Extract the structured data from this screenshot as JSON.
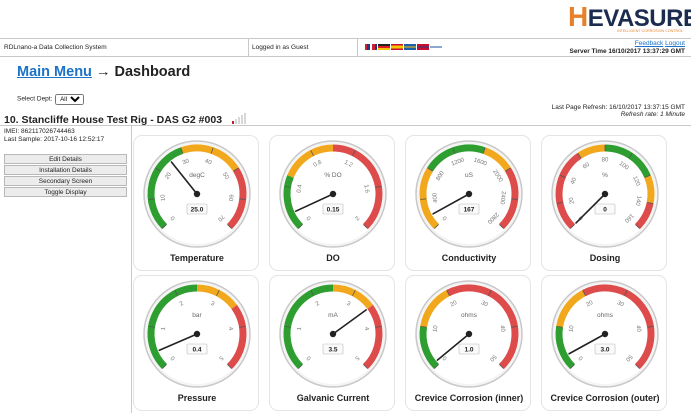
{
  "brand": {
    "name_h": "H",
    "name_rest": "EVASURE",
    "tagline": "INTELLIGENT CORROSION CONTROL"
  },
  "infobar": {
    "system": "RDLnano-a Data Collection System",
    "logged": "Logged in as Guest",
    "feedback": "Feedback",
    "logout": "Logout",
    "server_time": "Server Time 16/10/2017 13:37:29 GMT"
  },
  "breadcrumb": {
    "main": "Main Menu",
    "arrow": "→",
    "current": "Dashboard"
  },
  "dept": {
    "label": "Select Dept:",
    "value": "All"
  },
  "refresh": {
    "last": "Last Page Refresh: 16/10/2017 13:37:15 GMT",
    "rate": "Refresh rate: 1 Minute"
  },
  "rig": {
    "title": "10. Stancliffe House Test Rig - DAS G2 #003",
    "signal_bars": 1
  },
  "device": {
    "imei": "IMEI: 862117026744463",
    "last_sample": "Last Sample: 2017-10-16 12:52:17"
  },
  "menu": [
    "Edit Details",
    "Installation Details",
    "Secondary Screen",
    "Toggle Display"
  ],
  "colors": {
    "green": "#2e9e31",
    "amber": "#f2a81d",
    "red": "#dd4b4b",
    "link": "#1a73c8"
  },
  "gauges": [
    {
      "label": "Temperature",
      "unit": "degC",
      "value": 25.0,
      "display": "25.0",
      "min": 0,
      "max": 70,
      "ticks": [
        "0",
        "10",
        "20",
        "30",
        "40",
        "50",
        "60",
        "70"
      ],
      "zones": [
        [
          "green",
          0,
          30
        ],
        [
          "amber",
          30,
          50
        ],
        [
          "red",
          50,
          70
        ]
      ]
    },
    {
      "label": "DO",
      "unit": "% DO",
      "value": 0.15,
      "display": "0.15",
      "min": 0,
      "max": 2,
      "ticks": [
        "0",
        "0.4",
        "0.8",
        "1.2",
        "1.6",
        "2"
      ],
      "zones": [
        [
          "green",
          0,
          0.5
        ],
        [
          "amber",
          0.5,
          1.0
        ],
        [
          "red",
          1.0,
          2.0
        ]
      ]
    },
    {
      "label": "Conductivity",
      "unit": "uS",
      "value": 167,
      "display": "167",
      "min": 0,
      "max": 2800,
      "ticks": [
        "0",
        "400",
        "800",
        "1200",
        "1600",
        "2000",
        "2400",
        "2800"
      ],
      "zones": [
        [
          "amber",
          0,
          800
        ],
        [
          "green",
          800,
          1600
        ],
        [
          "amber",
          1600,
          2000
        ],
        [
          "red",
          2000,
          2800
        ]
      ]
    },
    {
      "label": "Dosing",
      "unit": "%",
      "value": 0,
      "display": "0",
      "min": 0,
      "max": 160,
      "ticks": [
        "0",
        "20",
        "40",
        "60",
        "80",
        "100",
        "120",
        "140",
        "160"
      ],
      "zones": [
        [
          "red",
          0,
          60
        ],
        [
          "amber",
          60,
          80
        ],
        [
          "green",
          80,
          120
        ],
        [
          "amber",
          120,
          140
        ],
        [
          "red",
          140,
          160
        ]
      ]
    },
    {
      "label": "Pressure",
      "unit": "bar",
      "value": 0.4,
      "display": "0.4",
      "min": 0,
      "max": 5,
      "ticks": [
        "0",
        "1",
        "2",
        "3",
        "4",
        "5"
      ],
      "zones": [
        [
          "green",
          0,
          2.5
        ],
        [
          "amber",
          2.5,
          3.5
        ],
        [
          "red",
          3.5,
          5
        ]
      ]
    },
    {
      "label": "Galvanic Current",
      "unit": "mA",
      "value": 3.5,
      "display": "3.5",
      "min": 0,
      "max": 5,
      "ticks": [
        "0",
        "1",
        "2",
        "3",
        "4",
        "5"
      ],
      "zones": [
        [
          "green",
          0,
          2.5
        ],
        [
          "amber",
          2.5,
          3.5
        ],
        [
          "red",
          3.5,
          5
        ]
      ]
    },
    {
      "label": "Crevice Corrosion (inner)",
      "unit": "ohms",
      "value": 1.0,
      "display": "1.0",
      "min": 0,
      "max": 50,
      "ticks": [
        "0",
        "10",
        "20",
        "30",
        "40",
        "50"
      ],
      "zones": [
        [
          "green",
          0,
          10
        ],
        [
          "amber",
          10,
          20
        ],
        [
          "red",
          20,
          50
        ]
      ]
    },
    {
      "label": "Crevice Corrosion (outer)",
      "unit": "ohms",
      "value": 3.0,
      "display": "3.0",
      "min": 0,
      "max": 50,
      "ticks": [
        "0",
        "10",
        "20",
        "30",
        "40",
        "50"
      ],
      "zones": [
        [
          "green",
          0,
          10
        ],
        [
          "amber",
          10,
          20
        ],
        [
          "red",
          20,
          50
        ]
      ]
    }
  ]
}
